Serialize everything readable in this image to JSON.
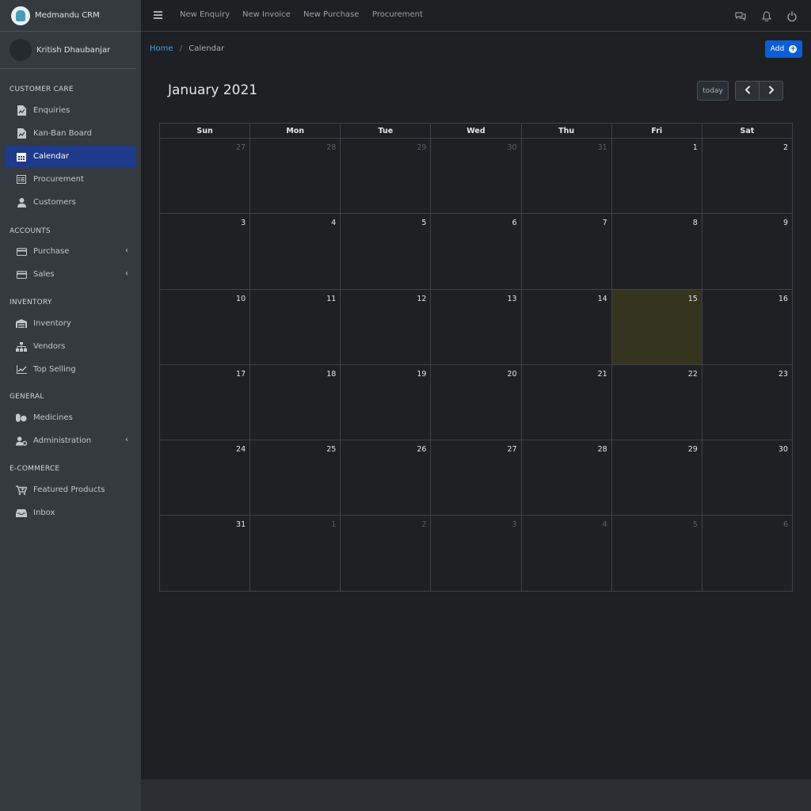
{
  "brand": {
    "name": "Medmandu CRM"
  },
  "user": {
    "name": "Kritish Dhaubanjar"
  },
  "sidebar": {
    "sections": [
      {
        "header": "CUSTOMER CARE"
      },
      {
        "header": "ACCOUNTS"
      },
      {
        "header": "INVENTORY"
      },
      {
        "header": "GENERAL"
      },
      {
        "header": "E-COMMERCE"
      }
    ],
    "items": [
      {
        "label": "Enquiries",
        "icon": "file-chart-icon"
      },
      {
        "label": "Kan-Ban Board",
        "icon": "file-chart-icon"
      },
      {
        "label": "Calendar",
        "icon": "calendar-icon",
        "active": true
      },
      {
        "label": "Procurement",
        "icon": "list-alt-icon"
      },
      {
        "label": "Customers",
        "icon": "user-icon"
      },
      {
        "label": "Purchase",
        "icon": "credit-card-icon"
      },
      {
        "label": "Sales",
        "icon": "credit-card-icon"
      },
      {
        "label": "Inventory",
        "icon": "warehouse-icon"
      },
      {
        "label": "Vendors",
        "icon": "sitemap-icon"
      },
      {
        "label": "Top Selling",
        "icon": "chart-line-icon"
      },
      {
        "label": "Medicines",
        "icon": "pills-icon"
      },
      {
        "label": "Administration",
        "icon": "users-cog-icon"
      },
      {
        "label": "Featured Products",
        "icon": "cart-plus-icon"
      },
      {
        "label": "Inbox",
        "icon": "inbox-icon"
      }
    ]
  },
  "topbar": {
    "links": [
      "New Enquiry",
      "New Invoice",
      "New Purchase",
      "Procurement"
    ],
    "icons": [
      "comments-icon",
      "bell-icon",
      "power-icon"
    ]
  },
  "breadcrumb": {
    "home": "Home",
    "separator": "/",
    "current": "Calendar"
  },
  "actions": {
    "add_label": "Add"
  },
  "calendar": {
    "title": "January 2021",
    "today_label": "today",
    "weekdays": [
      "Sun",
      "Mon",
      "Tue",
      "Wed",
      "Thu",
      "Fri",
      "Sat"
    ],
    "weeks": [
      [
        "27",
        "28",
        "29",
        "30",
        "31",
        "1",
        "2"
      ],
      [
        "3",
        "4",
        "5",
        "6",
        "7",
        "8",
        "9"
      ],
      [
        "10",
        "11",
        "12",
        "13",
        "14",
        "15",
        "16"
      ],
      [
        "17",
        "18",
        "19",
        "20",
        "21",
        "22",
        "23"
      ],
      [
        "24",
        "25",
        "26",
        "27",
        "28",
        "29",
        "30"
      ],
      [
        "31",
        "1",
        "2",
        "3",
        "4",
        "5",
        "6"
      ]
    ],
    "today": "15"
  },
  "colors": {
    "accent": "#0b5ed7",
    "active_nav": "#1e3a8a",
    "today_bg": "#35341f",
    "link": "#3f9df2"
  }
}
